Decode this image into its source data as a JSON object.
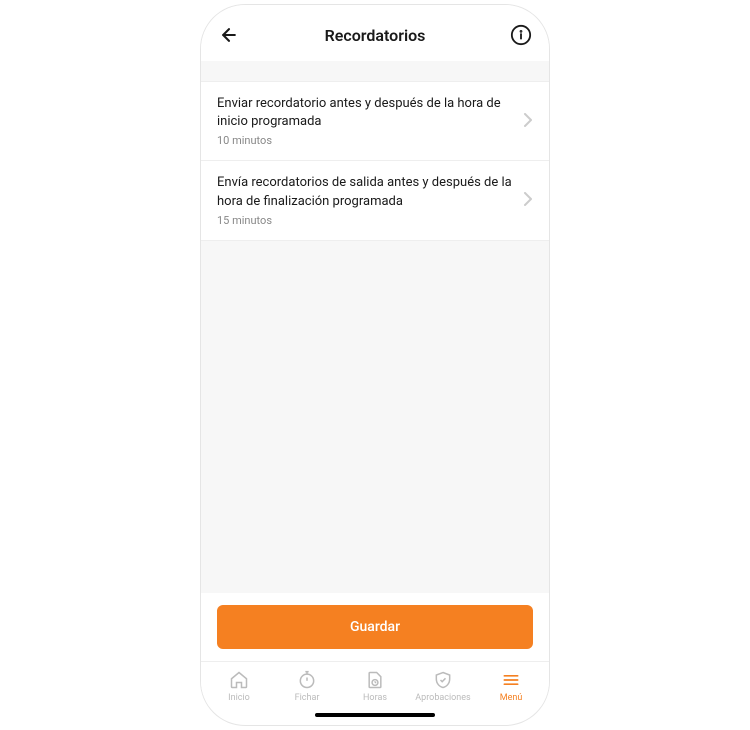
{
  "header": {
    "title": "Recordatorios"
  },
  "items": [
    {
      "title": "Enviar recordatorio antes y después de la hora de inicio programada",
      "subtitle": "10 minutos"
    },
    {
      "title": "Envía recordatorios de salida antes y después de la hora de finalización programada",
      "subtitle": "15 minutos"
    }
  ],
  "footer": {
    "save_label": "Guardar"
  },
  "tabs": [
    {
      "label": "Inicio"
    },
    {
      "label": "Fichar"
    },
    {
      "label": "Horas"
    },
    {
      "label": "Aprobaciones"
    },
    {
      "label": "Menú"
    }
  ],
  "colors": {
    "accent": "#f58021",
    "inactive": "#bbb"
  }
}
